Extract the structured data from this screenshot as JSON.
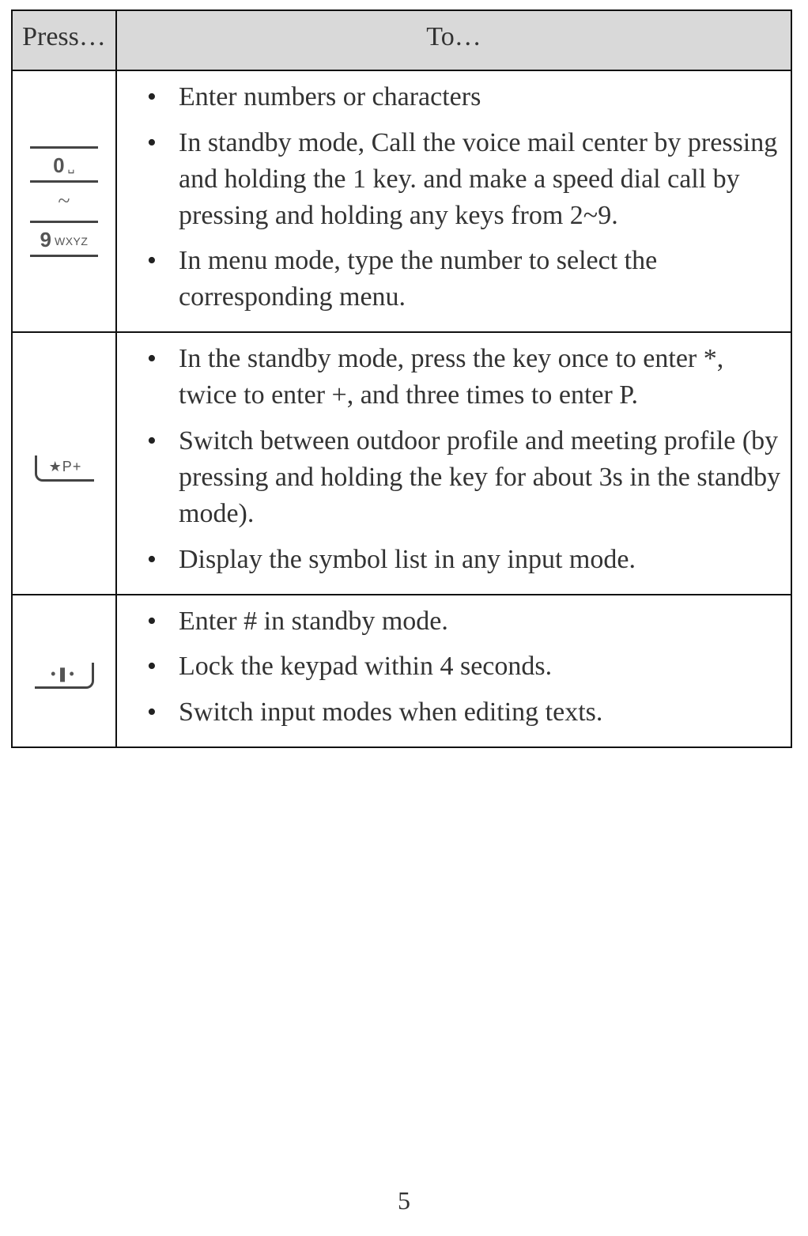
{
  "headers": {
    "press": "Press…",
    "to": "To…"
  },
  "rows": [
    {
      "key": {
        "type": "range",
        "top_big": "0",
        "top_small": "␣",
        "separator": "~",
        "bottom_big": "9",
        "bottom_small": "WXYZ"
      },
      "actions": [
        "Enter numbers or characters",
        "In standby mode, Call the voice mail center by pressing and holding the 1 key. and make a speed dial call by pressing and holding any keys from 2~9.",
        "In menu mode, type the number to select the corresponding menu."
      ]
    },
    {
      "key": {
        "type": "star",
        "glyph": "★P+"
      },
      "actions": [
        "In the standby mode, press the key once to enter *, twice to enter +, and three times to enter P.",
        "Switch between outdoor profile and meeting profile (by pressing and holding the key for about 3s in the standby mode).",
        "Display the symbol list in any input mode."
      ]
    },
    {
      "key": {
        "type": "hash",
        "glyph": "•❚•"
      },
      "actions": [
        "Enter # in standby mode.",
        "Lock the keypad within 4 seconds.",
        "Switch input modes when editing texts."
      ]
    }
  ],
  "page_number": "5"
}
